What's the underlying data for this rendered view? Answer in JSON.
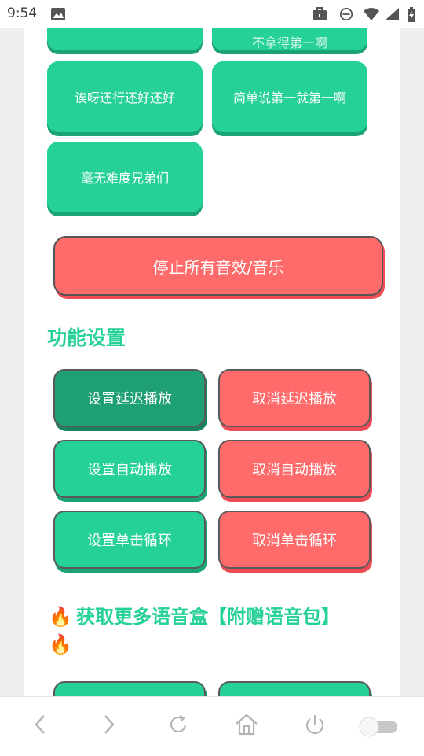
{
  "status_bar": {
    "time": "9:54",
    "icons": [
      "image-icon",
      "briefcase-icon",
      "do-not-disturb-icon",
      "wifi-icon",
      "signal-icon",
      "battery-charging-icon"
    ]
  },
  "sound_buttons": [
    {
      "label": "不拿得第一啊"
    },
    {
      "label": "诶呀还行还好还好"
    },
    {
      "label": "简单说第一就第一啊"
    },
    {
      "label": "毫无难度兄弟们"
    }
  ],
  "stop_all": {
    "label": "停止所有音效/音乐"
  },
  "settings": {
    "title": "功能设置",
    "buttons": [
      {
        "label": "设置延迟播放"
      },
      {
        "label": "取消延迟播放"
      },
      {
        "label": "设置自动播放"
      },
      {
        "label": "取消自动播放"
      },
      {
        "label": "设置单击循环"
      },
      {
        "label": "取消单击循环"
      }
    ]
  },
  "more": {
    "title": "获取更多语音盒【附赠语音包】",
    "fire_glyph": "🔥"
  },
  "nav": {
    "icons": [
      "back-icon",
      "forward-icon",
      "refresh-icon",
      "home-icon",
      "power-icon",
      "toggle-switch"
    ]
  },
  "colors": {
    "green": "#25d196",
    "green_dark": "#1f9f74",
    "red": "#ff6b6b",
    "page_bg": "#efefef"
  }
}
